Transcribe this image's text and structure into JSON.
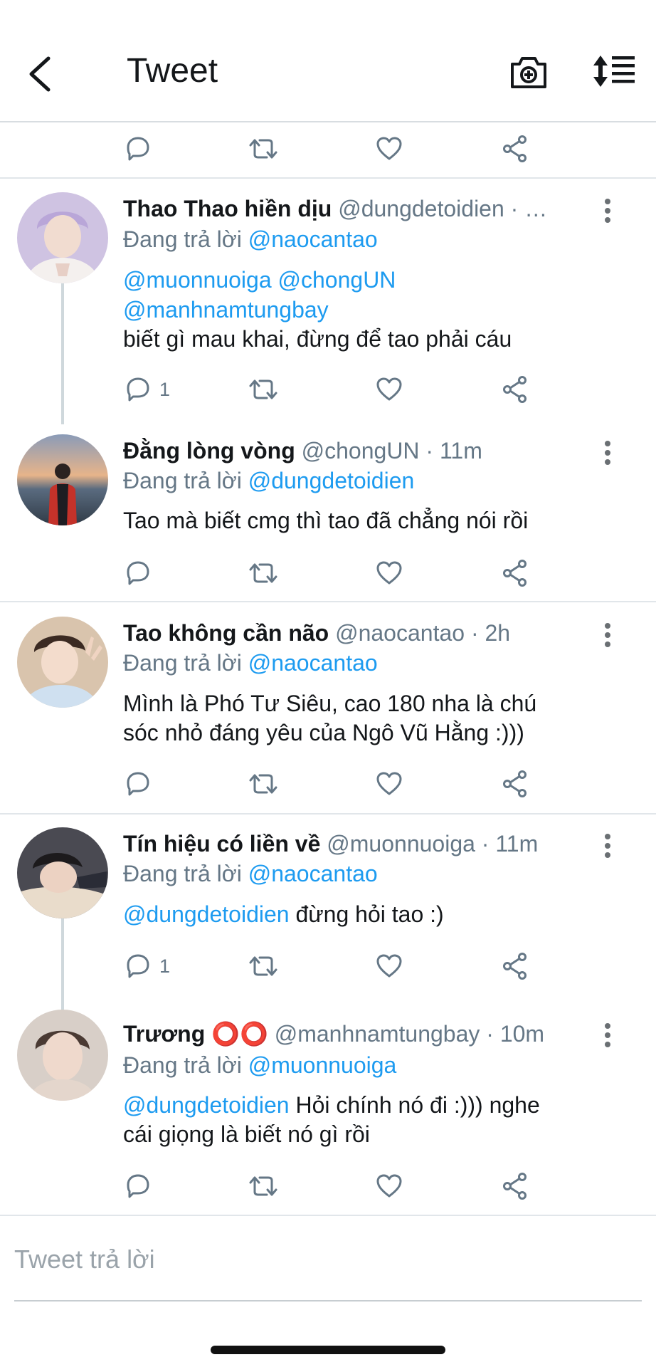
{
  "header": {
    "title": "Tweet",
    "icons": [
      "back-arrow-icon",
      "camera-plus-icon",
      "sort-list-icon"
    ]
  },
  "tweets": [
    {
      "name": "Thao Thao hiền dịu",
      "handle": "@dungdetoidien",
      "time": "· …",
      "reply_prefix": "Đang trả lời",
      "reply_to": "@naocantao",
      "mentions_line1": "@muonnuoiga @chongUN",
      "mentions_line2": "@manhnamtungbay",
      "text": "biết gì mau khai, đừng để tao phải cáu",
      "reply_count": "1"
    },
    {
      "name": "Đằng lòng vòng",
      "handle": "@chongUN",
      "time": "· 11m",
      "reply_prefix": "Đang trả lời",
      "reply_to": "@dungdetoidien",
      "text": "Tao mà biết cmg thì tao đã chẳng nói rồi",
      "reply_count": ""
    },
    {
      "name": "Tao không cần não",
      "handle": "@naocantao",
      "time": "· 2h",
      "reply_prefix": "Đang trả lời",
      "reply_to": "@naocantao",
      "text_line1": "Mình là Phó Tư Siêu, cao 180 nha là chú",
      "text_line2": "sóc nhỏ đáng yêu của Ngô Vũ Hằng :)))",
      "reply_count": ""
    },
    {
      "name": "Tín hiệu có liền về",
      "handle": "@muonnuoiga",
      "time": "· 11m",
      "reply_prefix": "Đang trả lời",
      "reply_to": "@naocantao",
      "mention": "@dungdetoidien",
      "text": " đừng hỏi tao :)",
      "reply_count": "1"
    },
    {
      "name": "Trương ⭕⭕",
      "handle": "@manhnamtungbay",
      "time": "· 10m",
      "reply_prefix": "Đang trả lời",
      "reply_to": "@muonnuoiga",
      "mention": "@dungdetoidien",
      "text": " Hỏi chính nó đi :))) nghe",
      "text_line2": "cái giọng là biết nó gì rồi",
      "reply_count": ""
    }
  ],
  "composer": {
    "placeholder": "Tweet trả lời"
  },
  "colors": {
    "link": "#1d9bf0",
    "secondary_text": "#657786",
    "divider": "#e1e6ea"
  }
}
